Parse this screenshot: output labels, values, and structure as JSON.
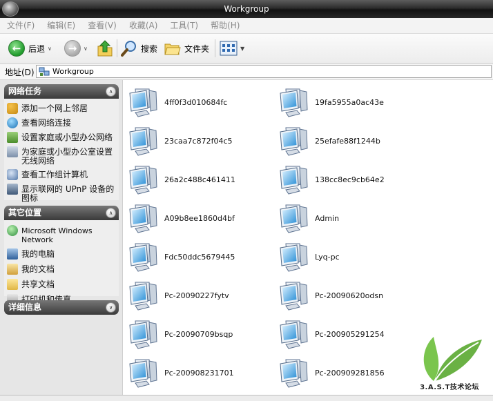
{
  "window": {
    "title": "Workgroup"
  },
  "menu": [
    "文件(F)",
    "编辑(E)",
    "查看(V)",
    "收藏(A)",
    "工具(T)",
    "帮助(H)"
  ],
  "toolbar": {
    "back_label": "后退",
    "search_label": "搜索",
    "folders_label": "文件夹"
  },
  "address": {
    "label": "地址(D)",
    "value": "Workgroup"
  },
  "network_tasks": {
    "title": "网络任务",
    "items": [
      {
        "label": "添加一个网上邻居",
        "icon": "add-network-place-icon"
      },
      {
        "label": "查看网络连接",
        "icon": "network-connections-icon"
      },
      {
        "label": "设置家庭或小型办公网络",
        "icon": "home-network-icon"
      },
      {
        "label": "为家庭或小型办公室设置无线网络",
        "icon": "wireless-network-icon"
      },
      {
        "label": "查看工作组计算机",
        "icon": "workgroup-computers-icon"
      },
      {
        "label": "显示联网的 UPnP 设备的图标",
        "icon": "upnp-device-icon"
      }
    ]
  },
  "other_places": {
    "title": "其它位置",
    "items": [
      {
        "label": "Microsoft Windows Network",
        "icon": "windows-network-icon"
      },
      {
        "label": "我的电脑",
        "icon": "my-computer-icon"
      },
      {
        "label": "我的文档",
        "icon": "my-documents-icon"
      },
      {
        "label": "共享文档",
        "icon": "shared-documents-icon"
      },
      {
        "label": "打印机和传真",
        "icon": "printer-icon"
      }
    ]
  },
  "details": {
    "title": "详细信息"
  },
  "computers": [
    "4ff0f3d010684fc",
    "19fa5955a0ac43e",
    "23caa7c872f04c5",
    "25efafe88f1244b",
    "26a2c488c461411",
    "138cc8ec9cb64e2",
    "A09b8ee1860d4bf",
    "Admin",
    "Fdc50ddc5679445",
    "Lyq-pc",
    "Pc-20090227fytv",
    "Pc-20090620odsn",
    "Pc-20090709bsqp",
    "Pc-200905291254",
    "Pc-200908231701",
    "Pc-200909281856"
  ],
  "watermark": {
    "text": "3.A.S.T技术论坛"
  }
}
